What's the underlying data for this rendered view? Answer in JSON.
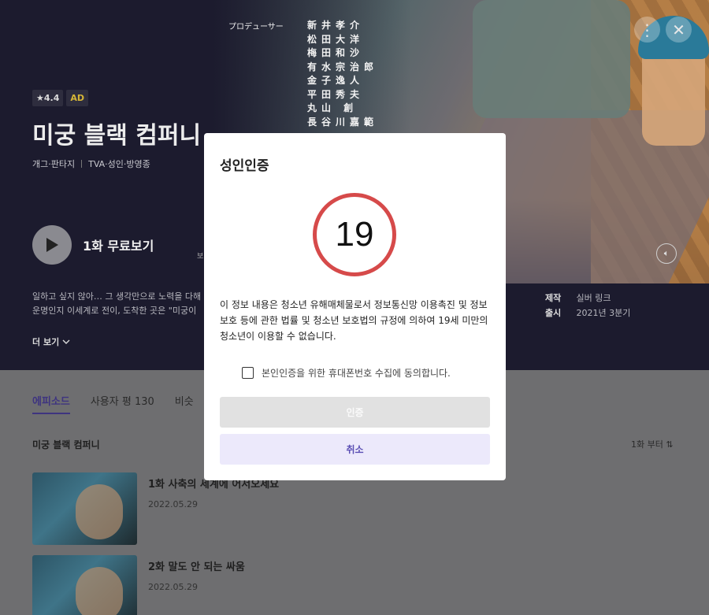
{
  "hero": {
    "credits_role": "プロデューサー",
    "credits_names": [
      "新井孝介",
      "松田大洋",
      "梅田和沙",
      "有水宗治郎",
      "金子逸人",
      "平田秀夫",
      "丸山 創",
      "長谷川嘉範"
    ],
    "rating": "★4.4",
    "ad_badge": "AD",
    "title": "미궁 블랙 컴퍼니",
    "genre": "개그·판타지",
    "status": "TVA·성인·방영종",
    "play_label": "1화 무료보기",
    "edge_text": "보",
    "description_line1": "일하고 싶지 않아… 그 생각만으로 노력을 다해",
    "description_line2": "운명인지 이세계로 전이, 도착한 곳은 \"미궁이",
    "more_label": "더 보기",
    "info": [
      {
        "key": "제작",
        "value": "실버 링크"
      },
      {
        "key": "출시",
        "value": "2021년 3분기"
      }
    ],
    "icons": {
      "menu": "more-vertical-icon",
      "close": "close-icon",
      "play": "play-icon",
      "sound": "speaker-icon",
      "chevron": "chevron-down-icon"
    }
  },
  "tabs": [
    {
      "label": "에피소드",
      "active": true
    },
    {
      "label": "사용자 평 130",
      "active": false
    },
    {
      "label": "비슷",
      "active": false
    }
  ],
  "series_title": "미궁 블랙 컴퍼니",
  "sort_label": "1화 부터 ⇅",
  "episodes": [
    {
      "title": "1화 사축의 세계에 어서오세요",
      "date": "2022.05.29"
    },
    {
      "title": "2화 말도 안 되는 싸움",
      "date": "2022.05.29"
    }
  ],
  "modal": {
    "title": "성인인증",
    "age": "19",
    "notice": "이 정보 내용은 청소년 유해매체물로서 정보통신망 이용촉진 및 정보보호 등에 관한 법률 및 청소년 보호법의 규정에 의하여 19세 미만의 청소년이 이용할 수 없습니다.",
    "consent_label": "본인인증을 위한 휴대폰번호 수집에 동의합니다.",
    "confirm_label": "인증",
    "cancel_label": "취소"
  },
  "colors": {
    "accent": "#3e3480",
    "age_ring": "#d64a4a",
    "cancel_bg": "#ece9fb",
    "cancel_text": "#5b4fb4",
    "ad": "#d6b636"
  }
}
